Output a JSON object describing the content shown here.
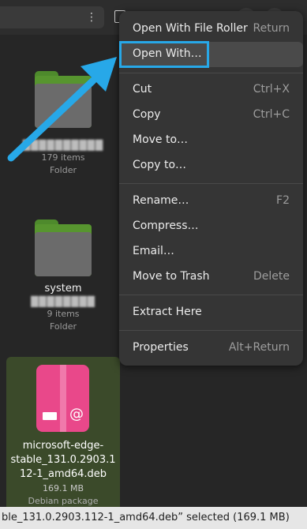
{
  "header": {
    "path_menu_glyph": "⋮"
  },
  "files": [
    {
      "name_blurred": "██████████",
      "count": "179 items",
      "type": "Folder"
    },
    {
      "name": "system",
      "name_blurred": "████████",
      "count": "9 items",
      "type": "Folder"
    },
    {
      "name": "microsoft-edge-stable_131.0.2903.112-1_amd64.deb",
      "name_lines": [
        "microsoft-edge-",
        "stable_131.0.2903.1",
        "12-1_amd64.deb"
      ],
      "size": "169.1 MB",
      "type": "Debian package"
    }
  ],
  "statusbar": {
    "text": "ble_131.0.2903.112-1_amd64.deb” selected  (169.1 MB)"
  },
  "menu": {
    "items": [
      {
        "label": "Open With File Roller",
        "accel": "Return"
      },
      {
        "label": "Open With…",
        "accel": ""
      },
      {
        "label": "Cut",
        "accel": "Ctrl+X"
      },
      {
        "label": "Copy",
        "accel": "Ctrl+C"
      },
      {
        "label": "Move to…",
        "accel": ""
      },
      {
        "label": "Copy to…",
        "accel": ""
      },
      {
        "label": "Rename…",
        "accel": "F2"
      },
      {
        "label": "Compress…",
        "accel": ""
      },
      {
        "label": "Email…",
        "accel": ""
      },
      {
        "label": "Move to Trash",
        "accel": "Delete"
      },
      {
        "label": "Extract Here",
        "accel": ""
      },
      {
        "label": "Properties",
        "accel": "Alt+Return"
      }
    ]
  },
  "colors": {
    "annotation_arrow": "#27a8e8",
    "folder_green": "#57952f",
    "deb_pink": "#e9488a"
  },
  "icons": {
    "folder": "folder-icon",
    "package": "debian-package-icon",
    "arrow": "annotation-arrow-icon"
  }
}
